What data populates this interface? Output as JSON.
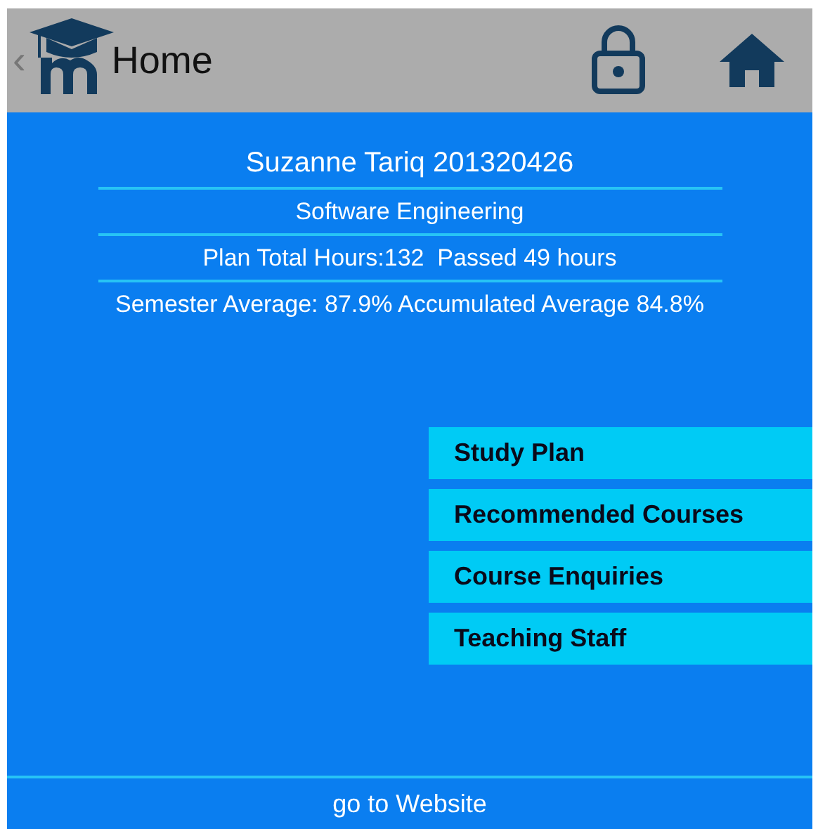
{
  "header": {
    "back": "‹",
    "title": "Home"
  },
  "student": {
    "name": "Suzanne Tariq 201320426",
    "program": "Software Engineering",
    "hours": "Plan Total Hours:132  Passed 49 hours",
    "averages": "Semester Average: 87.9% Accumulated Average 84.8%"
  },
  "menu": [
    {
      "label": "Study Plan"
    },
    {
      "label": "Recommended Courses"
    },
    {
      "label": "Course Enquiries"
    },
    {
      "label": "Teaching Staff"
    }
  ],
  "footer": {
    "link": "go to Website"
  }
}
